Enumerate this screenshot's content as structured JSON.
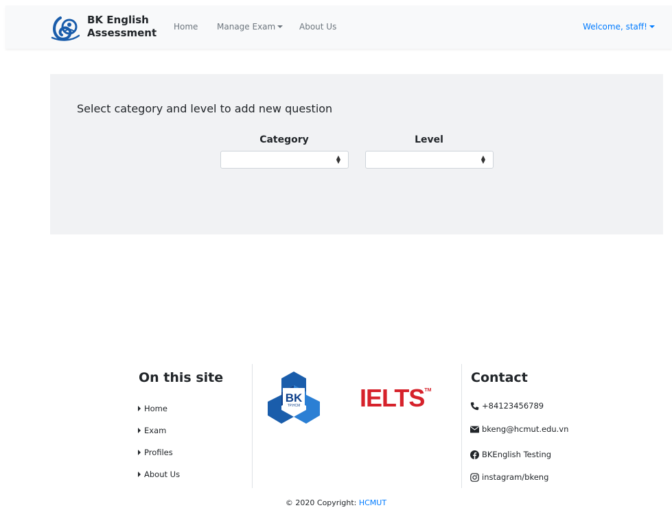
{
  "navbar": {
    "brand_line1": "BK English",
    "brand_line2": "Assessment",
    "home": "Home",
    "manage_exam": "Manage Exam",
    "about": "About Us",
    "welcome": "Welcome, staff!"
  },
  "panel": {
    "title": "Select category and level to add new question",
    "category_label": "Category",
    "level_label": "Level",
    "category_value": "",
    "level_value": ""
  },
  "footer": {
    "site_title": "On this site",
    "links": [
      "Home",
      "Exam",
      "Profiles",
      "About Us"
    ],
    "bk_logo_text": "BK",
    "bk_logo_sub": "TP.HCM",
    "ielts_text": "IELTS",
    "ielts_tm": "TM",
    "contact_title": "Contact",
    "phone": "+84123456789",
    "email": "bkeng@hcmut.edu.vn",
    "facebook": "BKEnglish Testing",
    "instagram": "instagram/bkeng",
    "copyright_prefix": "© 2020 Copyright: ",
    "copyright_link": "HCMUT"
  },
  "colors": {
    "accent": "#007bff",
    "ielts_red": "#d6222b",
    "bk_blue": "#1a5dab"
  },
  "icons": [
    "brand-logo-icon",
    "caret-down-icon",
    "caret-right-icon",
    "phone-icon",
    "envelope-icon",
    "facebook-icon",
    "instagram-icon"
  ]
}
